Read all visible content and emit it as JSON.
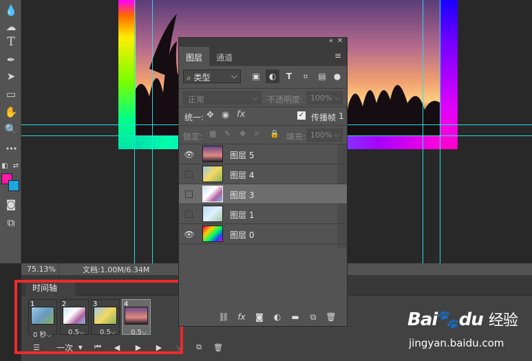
{
  "app": {
    "zoom": "75.13%",
    "doc_info": "文档:1.00M/6.34M"
  },
  "tools": [
    {
      "name": "drop-icon",
      "glyph": "💧"
    },
    {
      "name": "smudge-icon",
      "glyph": "☁"
    },
    {
      "name": "text-tool-icon",
      "glyph": "T"
    },
    {
      "name": "pen-tool-icon",
      "glyph": "✒"
    },
    {
      "name": "select-arrow-icon",
      "glyph": "➤"
    },
    {
      "name": "rectangle-tool-icon",
      "glyph": "▭"
    },
    {
      "name": "hand-tool-icon",
      "glyph": "✋"
    },
    {
      "name": "zoom-tool-icon",
      "glyph": "🔍"
    },
    {
      "name": "more-tools-icon",
      "glyph": "•••"
    }
  ],
  "colors": {
    "foreground": "#ff1aa8",
    "background": "#1aa8e0",
    "accent_red": "#ee2a2a",
    "guide": "#26e0e0"
  },
  "layers_panel": {
    "tabs": [
      {
        "label": "图层",
        "active": true
      },
      {
        "label": "通道",
        "active": false
      }
    ],
    "filter_label": "类型",
    "blend_mode": "正常",
    "opacity_label": "不透明度:",
    "opacity_value": "100%",
    "unify_label": "统一:",
    "propagate_label": "传播帧",
    "propagate_value": "1",
    "lock_label": "锁定:",
    "fill_label": "填充:",
    "fill_value": "100%",
    "layers": [
      {
        "name": "图层 5",
        "visible": true,
        "selected": false,
        "thumb": "linear-gradient(180deg,#6a4a8a,#e08a80 60%,#2a2030)"
      },
      {
        "name": "图层 4",
        "visible": false,
        "selected": false,
        "thumb": "linear-gradient(135deg,#9cc8e8,#f5d860 50%,#88b060)"
      },
      {
        "name": "图层 3",
        "visible": false,
        "selected": true,
        "thumb": "linear-gradient(135deg,#c8e0f0,#ffffff 40%,#b060a0 70%,#80c0e0)"
      },
      {
        "name": "图层 1",
        "visible": false,
        "selected": false,
        "thumb": "linear-gradient(135deg,#b8d8f0,#e0f0ff 50%,#a0c8a0)"
      },
      {
        "name": "图层 0",
        "visible": true,
        "selected": false,
        "thumb": "linear-gradient(135deg,#ff0040,#ffcc00 30%,#00ff60 55%,#2040ff 80%,#ff00cc)"
      }
    ]
  },
  "timeline": {
    "tab_label": "时间轴",
    "frames": [
      {
        "number": "1",
        "delay": "0 秒",
        "thumb": "linear-gradient(135deg,#9cc8e8,#6a9ac0 50%,#88b060)"
      },
      {
        "number": "2",
        "delay": "0.5",
        "thumb": "linear-gradient(135deg,#c8e0f0,#ffffff 40%,#b060a0 70%,#80c0e0)"
      },
      {
        "number": "3",
        "delay": "0.5",
        "thumb": "linear-gradient(135deg,#9cc8e8,#f5d860 50%,#88b060)"
      },
      {
        "number": "4",
        "delay": "0.5",
        "thumb": "linear-gradient(180deg,#6a4a8a,#e08a80 60%,#2a2030)"
      }
    ],
    "loop_label": "一次"
  },
  "watermark": {
    "brand": "Bai",
    "brand2": "du",
    "suffix": "经验",
    "url": "jingyan.baidu.com"
  }
}
